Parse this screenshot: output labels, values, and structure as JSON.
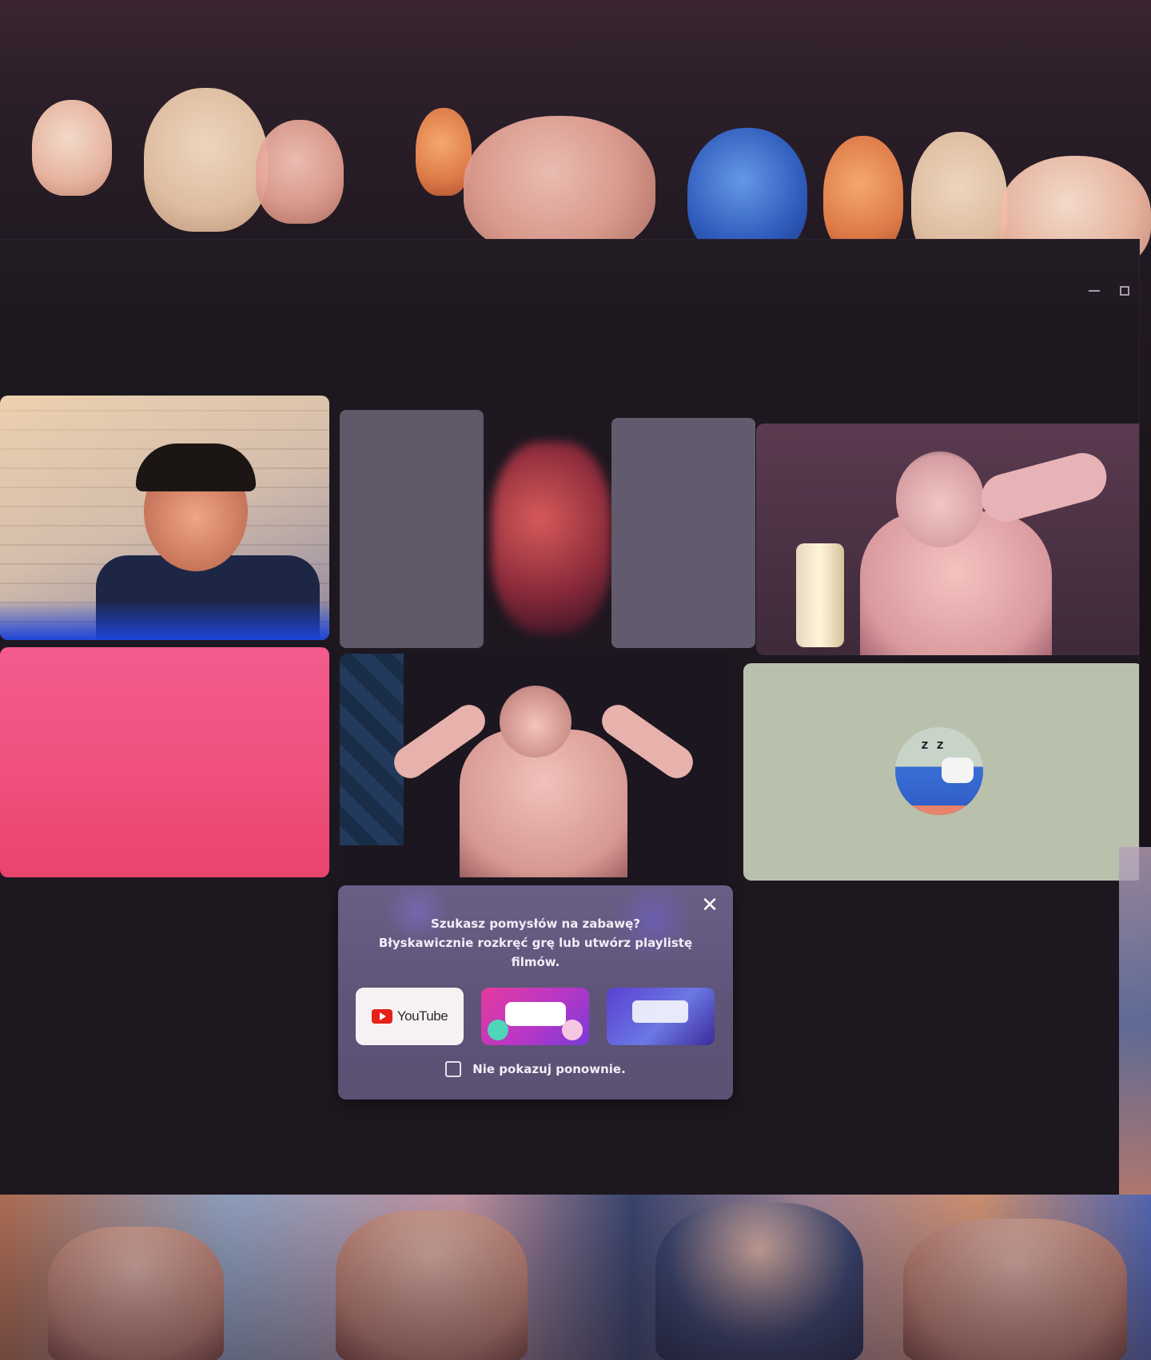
{
  "window": {
    "controls": {
      "minimize_icon": "minimize-icon",
      "maximize_icon": "maximize-icon"
    }
  },
  "activities_popup": {
    "title_line1": "Szukasz pomysłów na zabawę?",
    "title_line2": "Błyskawicznie rozkręć grę lub utwórz playlistę filmów.",
    "close_icon": "close-icon",
    "activities": [
      {
        "label": "YouTube",
        "icon": "youtube-play-icon"
      },
      {
        "label": "",
        "icon": "gartic-phone-logo"
      },
      {
        "label": "",
        "icon": "poker-night-logo"
      }
    ],
    "dont_show_again": "Nie pokazuj ponownie."
  },
  "colors": {
    "popup_bg": "#5e5478",
    "youtube_red": "#e62117",
    "pink_tile": "#ef4f7b",
    "sleep_tile": "#b9c1ad"
  }
}
